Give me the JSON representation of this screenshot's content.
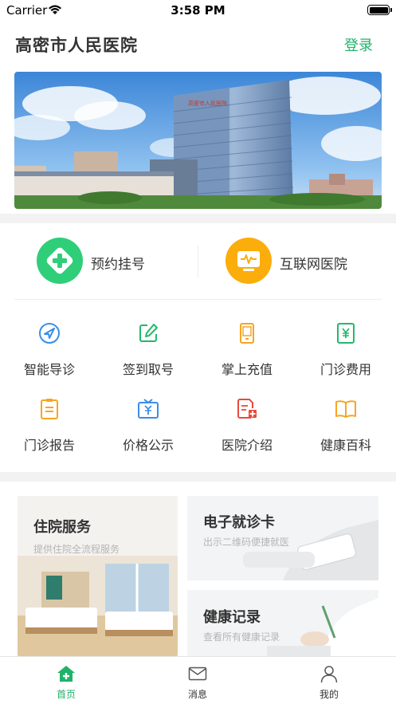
{
  "status_bar": {
    "carrier": "Carrier",
    "time": "3:58 PM"
  },
  "header": {
    "title": "高密市人民医院",
    "login_label": "登录"
  },
  "banner": {
    "sign_text": "高密市人民医院"
  },
  "big_entries": [
    {
      "label": "预约挂号",
      "icon": "plus-circle-icon",
      "color": "#2fce79"
    },
    {
      "label": "互联网医院",
      "icon": "monitor-pulse-icon",
      "color": "#fbad0c"
    }
  ],
  "grid": [
    {
      "label": "智能导诊",
      "icon": "navigation-icon",
      "color": "#3a8ee6"
    },
    {
      "label": "签到取号",
      "icon": "edit-icon",
      "color": "#24b96a"
    },
    {
      "label": "掌上充值",
      "icon": "phone-icon",
      "color": "#f5a623"
    },
    {
      "label": "门诊费用",
      "icon": "yuan-doc-icon",
      "color": "#24b96a"
    },
    {
      "label": "门诊报告",
      "icon": "clipboard-icon",
      "color": "#f5a623"
    },
    {
      "label": "价格公示",
      "icon": "yuan-board-icon",
      "color": "#3a8ee6"
    },
    {
      "label": "医院介绍",
      "icon": "hospital-doc-icon",
      "color": "#e84a3d"
    },
    {
      "label": "健康百科",
      "icon": "book-icon",
      "color": "#f5a623"
    }
  ],
  "cards": {
    "inpatient": {
      "title": "住院服务",
      "subtitle": "提供住院全流程服务"
    },
    "ecard": {
      "title": "电子就诊卡",
      "subtitle": "出示二维码便捷就医"
    },
    "records": {
      "title": "健康记录",
      "subtitle": "查看所有健康记录"
    }
  },
  "tabbar": [
    {
      "label": "首页",
      "icon": "home-icon",
      "active": true
    },
    {
      "label": "消息",
      "icon": "mail-icon",
      "active": false
    },
    {
      "label": "我的",
      "icon": "user-icon",
      "active": false
    }
  ],
  "colors": {
    "accent": "#20b26a",
    "divider": "#f2f2f2"
  }
}
